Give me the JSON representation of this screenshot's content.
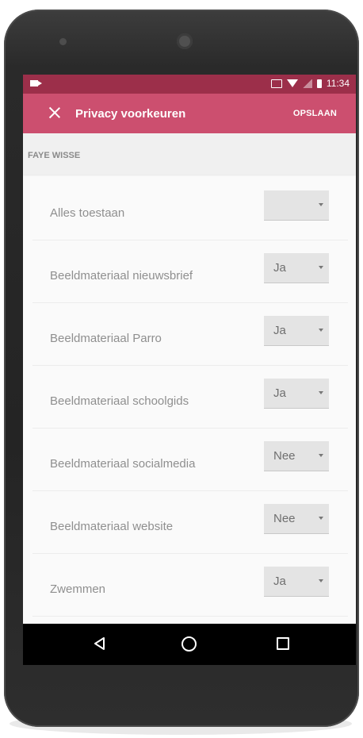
{
  "status_bar": {
    "time": "11:34"
  },
  "app_bar": {
    "title": "Privacy voorkeuren",
    "save_label": "OPSLAAN"
  },
  "section": {
    "header": "FAYE WISSE"
  },
  "settings": [
    {
      "label": "Alles toestaan",
      "value": ""
    },
    {
      "label": "Beeldmateriaal nieuwsbrief",
      "value": "Ja"
    },
    {
      "label": "Beeldmateriaal Parro",
      "value": "Ja"
    },
    {
      "label": "Beeldmateriaal schoolgids",
      "value": "Ja"
    },
    {
      "label": "Beeldmateriaal socialmedia",
      "value": "Nee"
    },
    {
      "label": "Beeldmateriaal website",
      "value": "Nee"
    },
    {
      "label": "Zwemmen",
      "value": "Ja"
    }
  ],
  "colors": {
    "status_bar": "#9c2f4a",
    "app_bar": "#cc4f6f",
    "screen_bg": "#fafafa",
    "select_bg": "#e4e4e4"
  },
  "icons": [
    "close-icon",
    "video-icon",
    "cast-icon",
    "wifi-icon",
    "signal-icon",
    "battery-icon",
    "nav-back-icon",
    "nav-home-icon",
    "nav-recent-icon",
    "chevron-down-icon"
  ]
}
